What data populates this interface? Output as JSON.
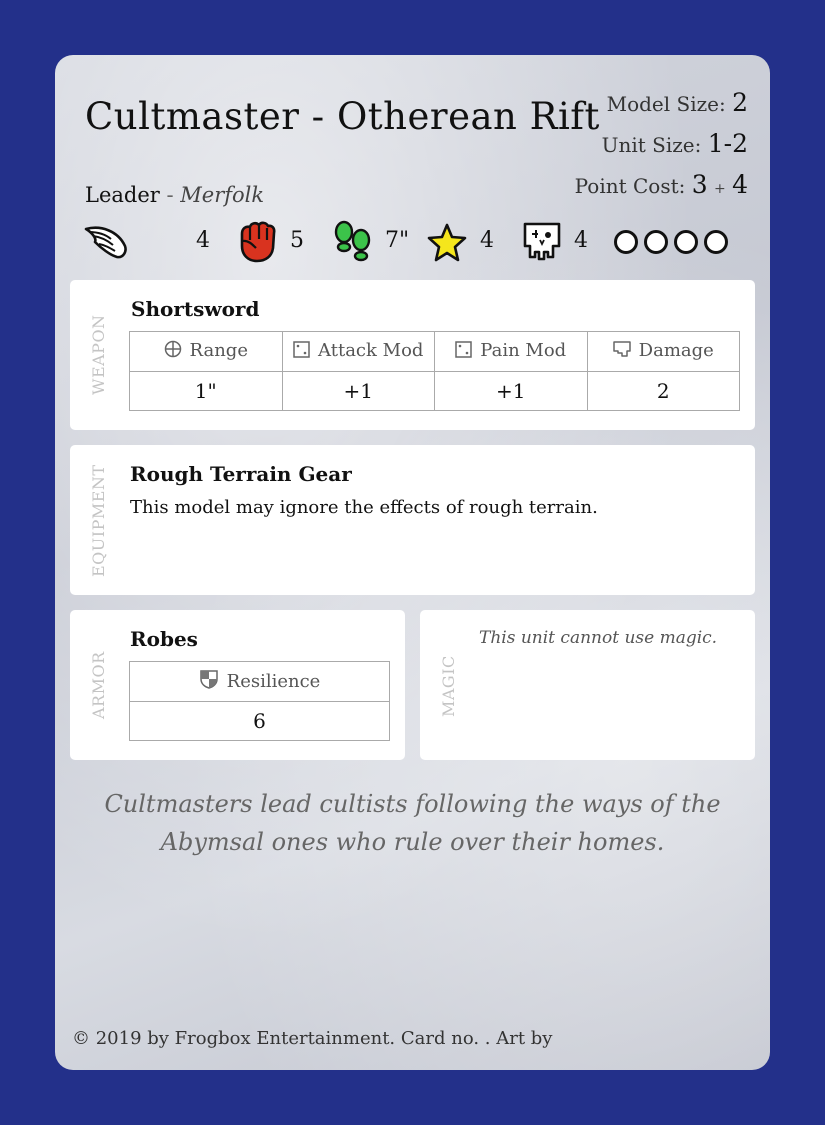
{
  "card": {
    "name": "Cultmaster - Otherean Rift",
    "model_size_label": "Model Size:",
    "model_size_value": "2",
    "unit_size_label": "Unit Size:",
    "unit_size_value": "1-2",
    "point_cost_label": "Point Cost:",
    "point_cost_base": "3",
    "point_cost_plus": "+",
    "point_cost_extra": "4",
    "leader_label": "Leader",
    "leader_separator": "-",
    "race": "Merfolk"
  },
  "stats": [
    {
      "icon": "wing-icon",
      "value": "4"
    },
    {
      "icon": "fist-icon",
      "value": "5"
    },
    {
      "icon": "footprints-icon",
      "value": "7\""
    },
    {
      "icon": "star-icon",
      "value": "4"
    },
    {
      "icon": "skull-icon",
      "value": "4"
    }
  ],
  "wound_circles": 4,
  "weapon": {
    "section_label": "WEAPON",
    "name": "Shortsword",
    "headers": [
      "Range",
      "Attack Mod",
      "Pain Mod",
      "Damage"
    ],
    "header_icons": [
      "crosshair-icon",
      "die-icon",
      "die-icon",
      "skull-outline-icon"
    ],
    "values": [
      "1\"",
      "+1",
      "+1",
      "2"
    ]
  },
  "equipment": {
    "section_label": "EQUIPMENT",
    "name": "Rough Terrain Gear",
    "text": "This model may ignore the effects of rough terrain."
  },
  "armor": {
    "section_label": "ARMOR",
    "name": "Robes",
    "header": "Resilience",
    "header_icon": "shield-icon",
    "value": "6"
  },
  "magic": {
    "section_label": "MAGIC",
    "note": "This unit cannot use magic."
  },
  "flavor": {
    "line1": "Cultmasters lead cultists following the ways of the",
    "line2": "Abymsal ones who rule over their homes."
  },
  "footer": "© 2019 by Frogbox Entertainment. Card no. . Art by",
  "colors": {
    "background": "#23308a",
    "fist": "#d9331f",
    "footprints": "#3cc34a",
    "star": "#f5e61c"
  }
}
